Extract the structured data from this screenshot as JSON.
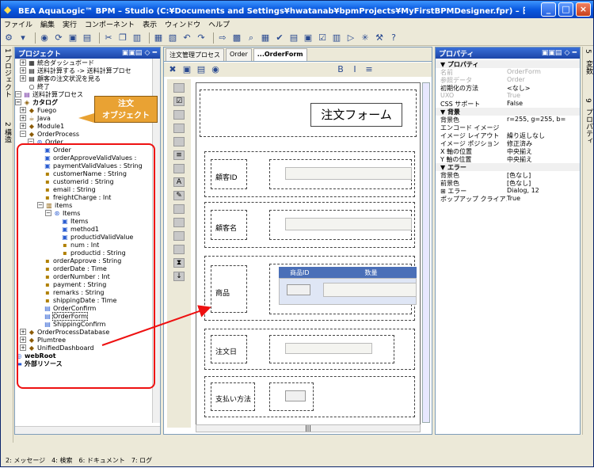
{
  "window": {
    "title": "BEA AquaLogic™ BPM – Studio  (C:¥Documents and Settings¥hwatanab¥bpmProjects¥MyFirstBPMDesigner.fpr) – 日本語"
  },
  "menu": [
    "ファイル",
    "編集",
    "実行",
    "コンポーネント",
    "表示",
    "ウィンドウ",
    "ヘルプ"
  ],
  "left_strip": {
    "num1": "1",
    "label1": "プロジェクト",
    "num2": "2",
    "label2": "構造"
  },
  "project_panel": {
    "title": "プロジェクト",
    "tree": [
      "統合ダッシュボード",
      "送料計算する -> 送料計算プロセ",
      "顧客の注文状況を見る",
      "終了",
      "送料計算プロセス",
      "カタログ",
      "Fuego",
      "Java",
      "Module1",
      "OrderProcess",
      "Order",
      "Order",
      "orderApproveValidValues :",
      "paymentValidValues : String",
      "customerName : String",
      "customerid : String",
      "email : String",
      "freightCharge : Int",
      "items",
      "Items",
      "Items",
      "method1",
      "productidValidValue",
      "num : Int",
      "productid : String",
      "orderApprove : String",
      "orderDate : Time",
      "orderNumber : Int",
      "payment : String",
      "remarks : String",
      "shippingDate : Time",
      "OrderConfirm",
      "OrderForm",
      "ShippingConfirm",
      "OrderProcessDatabase",
      "Plumtree",
      "UnifiedDashboard",
      "webRoot",
      "外部リソース"
    ]
  },
  "callout": {
    "line1": "注文",
    "line2": "オブジェクト"
  },
  "editor": {
    "tabs": [
      "注文管理プロセス",
      "Order",
      "...OrderForm"
    ],
    "form_title": "注文フォーム",
    "labels": [
      "顧客ID",
      "顧客名",
      "商品",
      "注文日",
      "支払い方法"
    ],
    "grid_headers": [
      "商品ID",
      "数量"
    ]
  },
  "properties": {
    "title": "プロパティ",
    "rows": [
      {
        "k": "▼ プロパティ",
        "v": "",
        "type": "cat"
      },
      {
        "k": "名前",
        "v": "OrderForm",
        "type": "dis"
      },
      {
        "k": "参照データ",
        "v": "Order",
        "type": "dis"
      },
      {
        "k": "初期化の方法",
        "v": "<なし>",
        "type": ""
      },
      {
        "k": "UXO",
        "v": "True",
        "type": "dis"
      },
      {
        "k": "CSS サポート",
        "v": "False",
        "type": ""
      },
      {
        "k": "▼ 背景",
        "v": "",
        "type": "cat"
      },
      {
        "k": "背景色",
        "v": "r=255, g=255, b=",
        "type": ""
      },
      {
        "k": "エンコード イメージ",
        "v": "",
        "type": ""
      },
      {
        "k": "イメージ レイアウト",
        "v": "繰り返しなし",
        "type": ""
      },
      {
        "k": "イメージ ポジション",
        "v": "修正済み",
        "type": ""
      },
      {
        "k": "X 軸の位置",
        "v": "中央揃え",
        "type": ""
      },
      {
        "k": "Y 軸の位置",
        "v": "中央揃え",
        "type": ""
      },
      {
        "k": "▼ エラー",
        "v": "",
        "type": "cat"
      },
      {
        "k": "背景色",
        "v": "[色なし]",
        "type": ""
      },
      {
        "k": "前景色",
        "v": "[色なし]",
        "type": ""
      },
      {
        "k": "⊞ エラー",
        "v": "Dialog, 12",
        "type": ""
      },
      {
        "k": "ポップアップ クライアン",
        "v": "True",
        "type": ""
      }
    ]
  },
  "right_strip": {
    "n5": "5",
    "l1": "変数",
    "n9": "9",
    "l2": "プロパティ"
  },
  "statusbar": [
    "2: メッセージ",
    "4: 検索",
    "6: ドキュメント",
    "7: ログ"
  ],
  "colors": {
    "callout": "#e9a233",
    "highlight": "#ee1111",
    "titlebar": "#0a5ae0"
  }
}
